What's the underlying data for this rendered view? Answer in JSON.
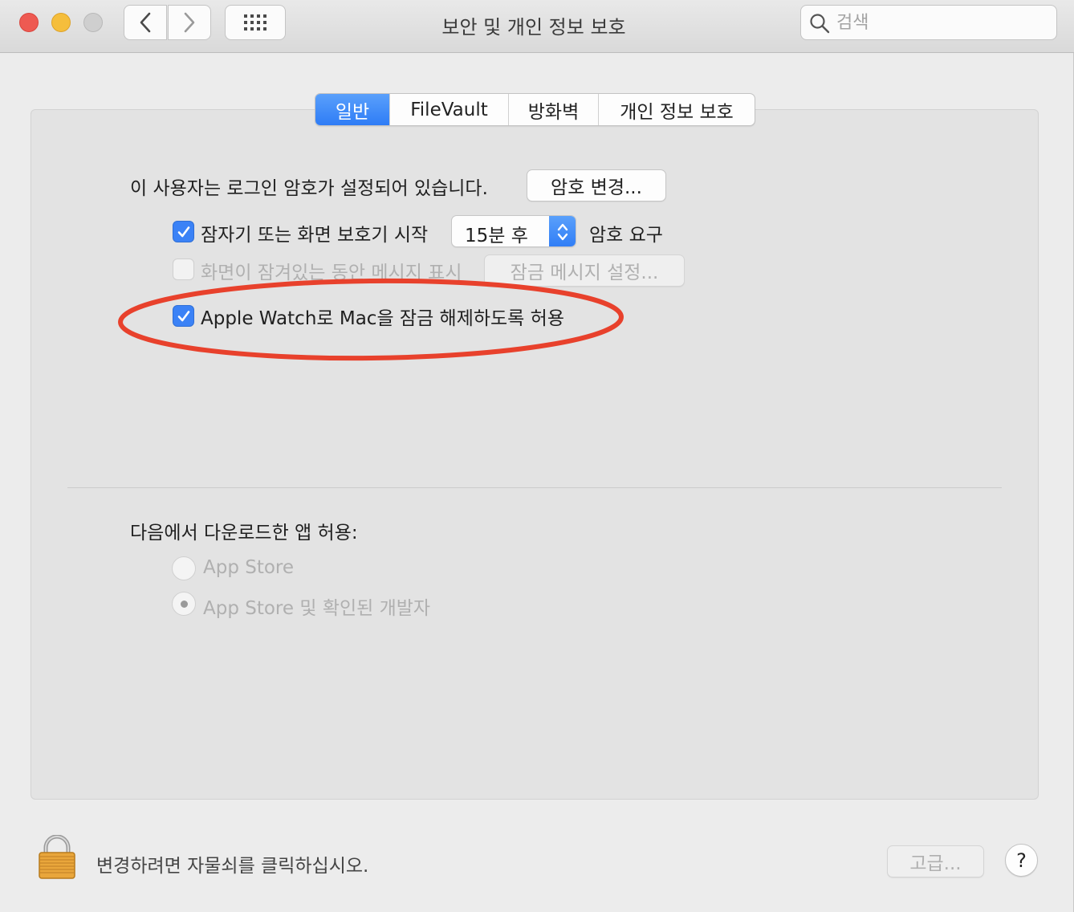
{
  "window": {
    "title": "보안 및 개인 정보 보호",
    "search_placeholder": "검색"
  },
  "tabs": [
    {
      "label": "일반",
      "active": true
    },
    {
      "label": "FileVault",
      "active": false
    },
    {
      "label": "방화벽",
      "active": false
    },
    {
      "label": "개인 정보 보호",
      "active": false
    }
  ],
  "general": {
    "password_set_text": "이 사용자는 로그인 암호가 설정되어 있습니다.",
    "change_password_button": "암호 변경...",
    "require_password": {
      "checked": true,
      "label": "잠자기 또는 화면 보호기 시작",
      "delay_value": "15분 후",
      "suffix": "암호 요구"
    },
    "show_message": {
      "checked": false,
      "enabled": false,
      "label": "화면이 잠겨있는 동안 메시지 표시",
      "button": "잠금 메시지 설정..."
    },
    "apple_watch": {
      "checked": true,
      "label": "Apple Watch로 Mac을 잠금 해제하도록 허용"
    }
  },
  "downloads": {
    "heading": "다음에서 다운로드한 앱 허용:",
    "options": [
      {
        "label": "App Store",
        "selected": false
      },
      {
        "label": "App Store 및 확인된 개발자",
        "selected": true
      }
    ]
  },
  "footer": {
    "lock_text": "변경하려면 자물쇠를 클릭하십시오.",
    "advanced_button": "고급...",
    "help_button": "?"
  },
  "colors": {
    "accent": "#2e7cf6",
    "annotation": "#e8412c"
  }
}
